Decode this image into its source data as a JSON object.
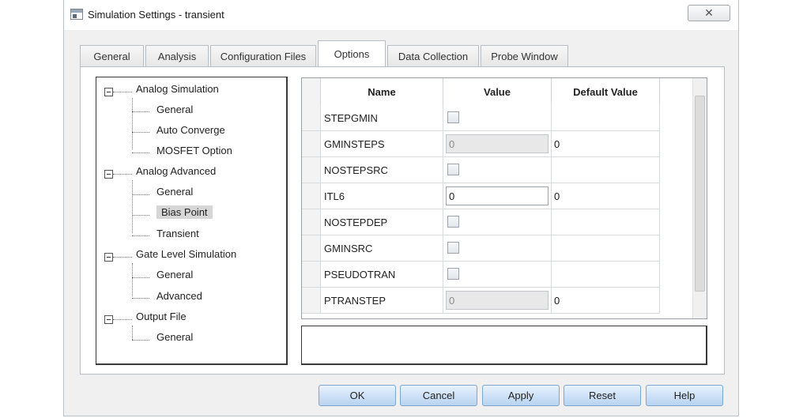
{
  "window": {
    "title": "Simulation Settings - transient",
    "close_glyph": "✕"
  },
  "tabs": [
    "General",
    "Analysis",
    "Configuration Files",
    "Options",
    "Data Collection",
    "Probe Window"
  ],
  "active_tab": "Options",
  "tree": {
    "groups": [
      {
        "label": "Analog Simulation",
        "children": [
          "General",
          "Auto Converge",
          "MOSFET Option"
        ]
      },
      {
        "label": "Analog Advanced",
        "children": [
          "General",
          "Bias Point",
          "Transient"
        ]
      },
      {
        "label": "Gate Level Simulation",
        "children": [
          "General",
          "Advanced"
        ]
      },
      {
        "label": "Output File",
        "children": [
          "General"
        ]
      }
    ],
    "selected": "Bias Point"
  },
  "grid": {
    "headers": {
      "name": "Name",
      "value": "Value",
      "default": "Default Value"
    },
    "rows": [
      {
        "name": "STEPGMIN",
        "type": "checkbox",
        "value": "",
        "default": ""
      },
      {
        "name": "GMINSTEPS",
        "type": "text-disabled",
        "value": "0",
        "default": "0"
      },
      {
        "name": "NOSTEPSRC",
        "type": "checkbox",
        "value": "",
        "default": ""
      },
      {
        "name": "ITL6",
        "type": "text",
        "value": "0",
        "default": "0"
      },
      {
        "name": "NOSTEPDEP",
        "type": "checkbox",
        "value": "",
        "default": ""
      },
      {
        "name": "GMINSRC",
        "type": "checkbox",
        "value": "",
        "default": ""
      },
      {
        "name": "PSEUDOTRAN",
        "type": "checkbox",
        "value": "",
        "default": ""
      },
      {
        "name": "PTRANSTEP",
        "type": "text-disabled",
        "value": "0",
        "default": "0"
      }
    ]
  },
  "buttons": {
    "ok": "OK",
    "cancel": "Cancel",
    "apply": "Apply",
    "reset": "Reset",
    "help": "Help"
  }
}
